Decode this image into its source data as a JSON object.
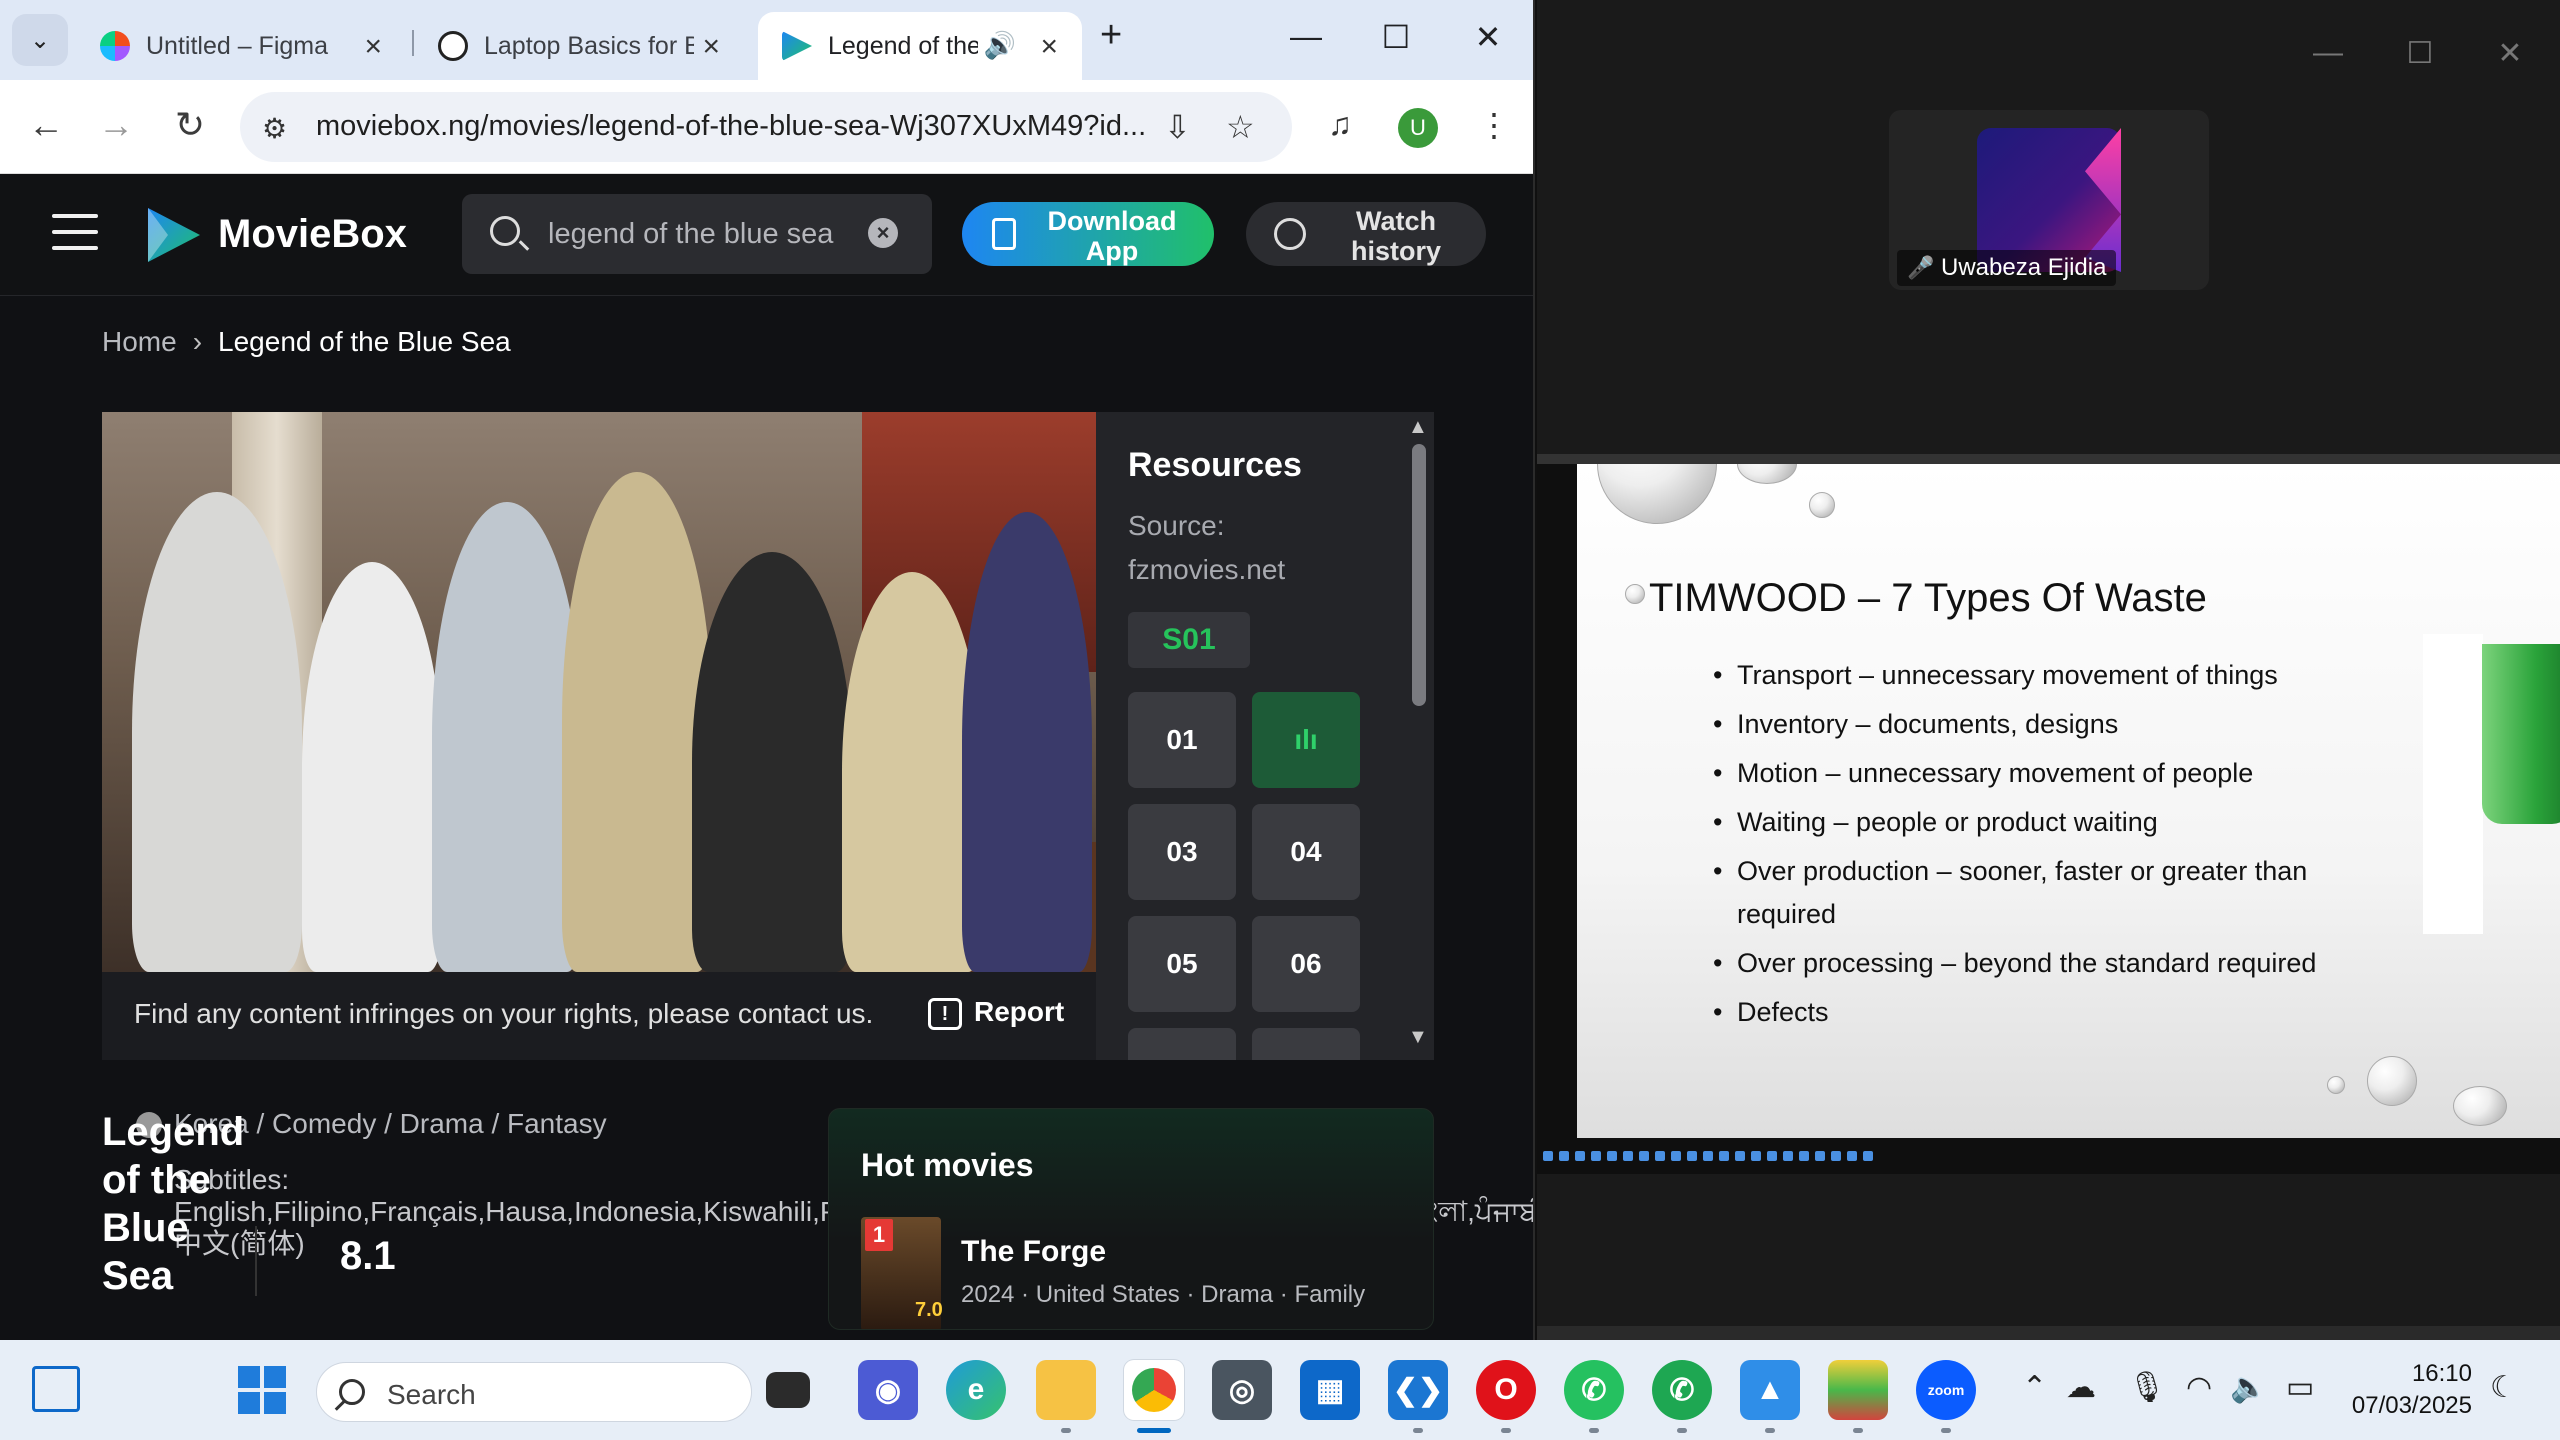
{
  "browser": {
    "tabs": [
      {
        "title": "Untitled – Figma",
        "favicon": "figma-icon"
      },
      {
        "title": "Laptop Basics for B",
        "favicon": "openai-icon"
      },
      {
        "title": "Legend of the",
        "favicon": "moviebox-icon",
        "active": true
      }
    ],
    "url": "moviebox.ng/movies/legend-of-the-blue-sea-Wj307XUxM49?id...",
    "profile_initial": "U"
  },
  "moviebox": {
    "brand": "MovieBox",
    "search_value": "legend of the blue sea",
    "download_label": "Download App",
    "history_label": "Watch history",
    "breadcrumb": {
      "home": "Home",
      "current": "Legend of the Blue Sea"
    },
    "notice": "Find any content infringes on your rights, please contact us.",
    "report_label": "Report",
    "resources": {
      "title": "Resources",
      "source_label": "Source:",
      "source_value": "fzmovies.net",
      "season": "S01",
      "episodes": [
        "01",
        "",
        "03",
        "04",
        "05",
        "06"
      ],
      "playing_episode": "02"
    },
    "movie": {
      "title": "Legend of the Blue Sea",
      "genres": "Korea / Comedy / Drama / Fantasy",
      "subtitles": "Subtitles: English,Filipino,Français,Hausa,Indonesia,Kiswahili,Português,es,fa,ms,th,tr,vi,Русский,اردو,العربية,বাংলা,ਪੰਜਾਬੀ,中文(简体)",
      "rating": "8.1"
    },
    "hot": {
      "heading": "Hot movies",
      "items": [
        {
          "rank": "1",
          "title": "The Forge",
          "meta": "2024 · United States · Drama · Family",
          "score": "7.0"
        }
      ]
    }
  },
  "zoom": {
    "participant_name": "Uwabeza Ejidia",
    "slide": {
      "title": "TIMWOOD – 7 Types Of Waste",
      "bullets": [
        "Transport – unnecessary movement of things",
        "Inventory – documents, designs",
        "Motion – unnecessary movement of people",
        "Waiting – people or product waiting",
        "Over production – sooner, faster or greater than required",
        "Over processing – beyond the standard required",
        "Defects"
      ]
    }
  },
  "taskbar": {
    "search_placeholder": "Search",
    "time": "16:10",
    "date": "07/03/2025",
    "apps": [
      "task-view",
      "copilot",
      "edge",
      "file-explorer",
      "chrome",
      "camera",
      "microsoft-store",
      "vscode",
      "opera",
      "whatsapp",
      "whatsapp-beta",
      "photos",
      "bluestacks",
      "zoom"
    ]
  }
}
